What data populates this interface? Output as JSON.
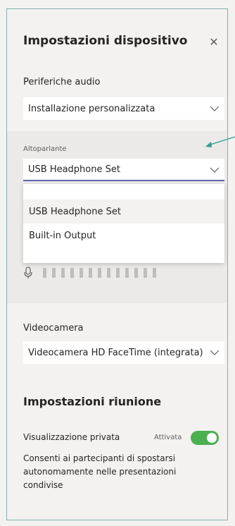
{
  "panel": {
    "title": "Impostazioni dispositivo"
  },
  "audio": {
    "label": "Periferiche audio",
    "value": "Installazione personalizzata"
  },
  "speaker": {
    "label": "Altoparlante",
    "value": "USB Headphone Set",
    "options": [
      "USB Headphone Set",
      "Built-in Output"
    ]
  },
  "camera": {
    "label": "Videocamera",
    "value": "Videocamera HD FaceTime (integrata)"
  },
  "meeting": {
    "title": "Impostazioni riunione",
    "private_view_label": "Visualizzazione privata",
    "private_view_state": "Attivata",
    "description": "Consenti ai partecipanti di spostarsi autonomamente nelle presentazioni condivise"
  },
  "icons": {
    "close": "close-icon",
    "chevron": "chevron-down-icon",
    "mic": "microphone-icon"
  },
  "colors": {
    "accent": "#6264a7",
    "toggle_on": "#4caf50",
    "annotation": "#2e9e8f"
  },
  "mic_level": {
    "active_bars": 0,
    "total_bars": 13
  }
}
